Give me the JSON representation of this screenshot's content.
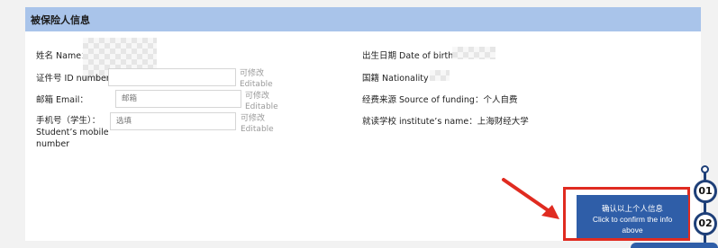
{
  "panel": {
    "title": "被保险人信息"
  },
  "left": {
    "name": {
      "label": "姓名 Name："
    },
    "id": {
      "label": "证件号 ID number：",
      "placeholder": "",
      "hint_line1": "可修改",
      "hint_line2": "Editable"
    },
    "email": {
      "label": "邮箱 Email：",
      "placeholder": "邮箱",
      "hint_line1": "可修改",
      "hint_line2": "Editable"
    },
    "mobile": {
      "label_line1": "手机号（学生）：",
      "label_line2": "Student’s mobile",
      "label_line3": "number",
      "placeholder": "选填",
      "hint_line1": "可修改",
      "hint_line2": "Editable"
    }
  },
  "right": {
    "dob": {
      "label": "出生日期 Date of birth："
    },
    "nationality": {
      "label": "国籍 Nationality："
    },
    "funding": {
      "label": "经费来源 Source of funding：个人自费"
    },
    "institute": {
      "label": "就读学校 institute’s name：上海财经大学"
    }
  },
  "confirm": {
    "line1": "确认以上个人信息",
    "line2": "Click to confirm the info",
    "line3": "above"
  },
  "steps": [
    "01",
    "02"
  ],
  "colors": {
    "header": "#a9c4ea",
    "button": "#2f5ea8",
    "highlight": "#e02b20",
    "step_ring": "#1e3f78"
  }
}
